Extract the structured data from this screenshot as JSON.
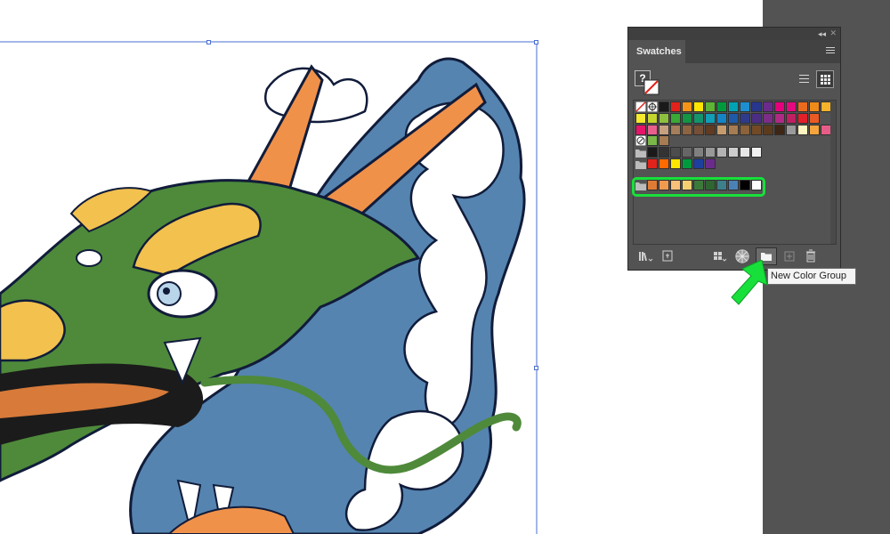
{
  "panel": {
    "tab_title": "Swatches",
    "collapse_glyph": "◂◂",
    "close_glyph": "✕",
    "fill_placeholder": "?",
    "views": [
      "list-view-icon",
      "grid-view-icon"
    ]
  },
  "swatch_rows": {
    "row1": [
      "#ffffff",
      "#ffffff",
      "#1a1a1a",
      "#e1231b",
      "#f39418",
      "#ffe600",
      "#5db435",
      "#009a3d",
      "#00a3b4",
      "#1d8fd1",
      "#27378d",
      "#6b2b8d",
      "#e6007e",
      "#e5097f",
      "#ec6a1d",
      "#f08a19",
      "#f7b32b"
    ],
    "row2": [
      "#f5ea2e",
      "#c4d52d",
      "#8dc03f",
      "#3aa935",
      "#139543",
      "#13946d",
      "#119eb7",
      "#1484c6",
      "#1e5aa8",
      "#2e3a8a",
      "#4b2d84",
      "#7c2d87",
      "#b02a85",
      "#c01f62",
      "#e2202a",
      "#ea5a24"
    ],
    "row3": [
      "#e6156a",
      "#e85f8d",
      "#c7a07f",
      "#a57e5b",
      "#8d6442",
      "#765036",
      "#5e3b22",
      "#c69c6d",
      "#a67c52",
      "#8b6239",
      "#734a26",
      "#5c3a1c",
      "#3e2614",
      "#9a9a9a",
      "#fff5c0",
      "#f6a43d",
      "#e85d88"
    ],
    "row5_grays": [
      "#1a1a1a",
      "#333333",
      "#4d4d4d",
      "#666666",
      "#808080",
      "#999999",
      "#b3b3b3",
      "#cccccc",
      "#e6e6e6",
      "#f2f2f2"
    ],
    "row6": [
      "#e1231b",
      "#ff6a00",
      "#ffe600",
      "#009a3d",
      "#1d3f9e",
      "#6b2b8d"
    ],
    "row7_group": [
      "#e07b35",
      "#f09a50",
      "#f8c07a",
      "#f4d070",
      "#3c7a3a",
      "#2f6530",
      "#3d7f8a",
      "#4a82b5",
      "#000000",
      "#ffffff"
    ]
  },
  "tooltip": {
    "text": "New Color Group"
  },
  "bottom_icons": [
    "swatch-libraries-icon",
    "place-swatches-icon",
    "show-kinds-icon",
    "swatch-options-icon",
    "new-color-group-icon",
    "new-swatch-icon",
    "delete-swatch-icon"
  ],
  "colors": {
    "highlight": "#17e03a",
    "pasteboard": "#535353",
    "selection": "#4a6fd1"
  }
}
